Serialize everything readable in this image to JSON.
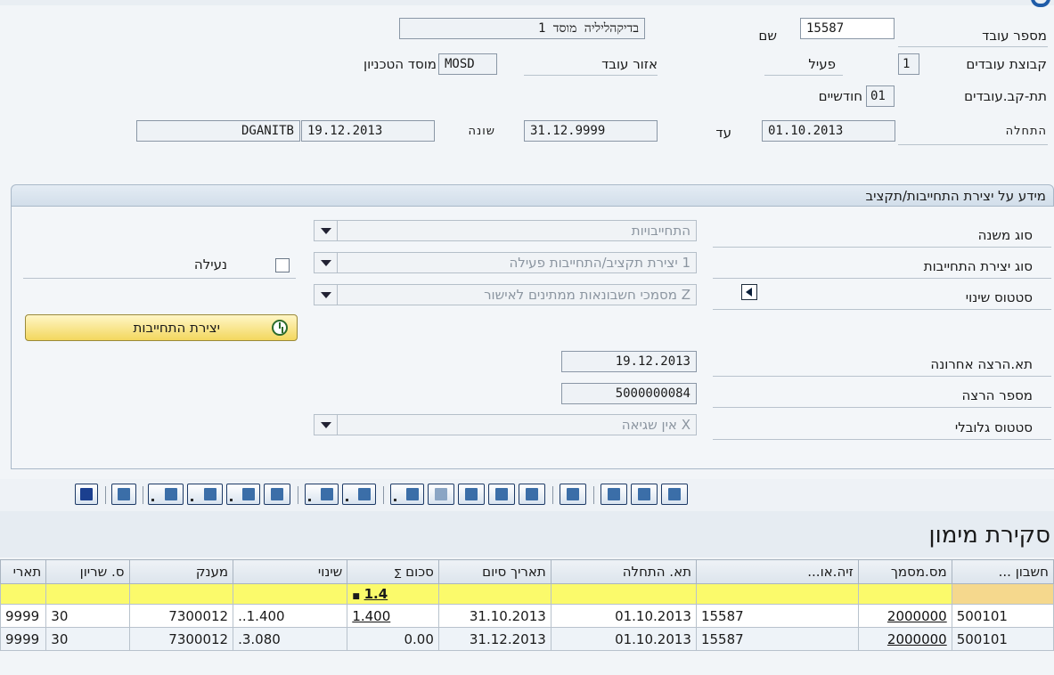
{
  "header": {
    "employee_no_label": "מספר עובד",
    "employee_no": "15587",
    "name_label": "שם",
    "name": "בדיקהליליה מוסד 1",
    "employee_group_label": "קבוצת עובדים",
    "employee_group_code": "1",
    "employee_group_text": "פעיל",
    "employee_area_label": "אזור עובד",
    "employee_area_code": "MOSD",
    "employee_area_text": "מוסד הטכניון",
    "subgroup_label": "תת-קב.עובדים",
    "subgroup_code": "01",
    "subgroup_text": "חודשיים",
    "start_label": "התחלה",
    "start_date": "01.10.2013",
    "until_label": "עד",
    "end_date": "31.12.9999",
    "changed_label": "שונה",
    "changed_date": "19.12.2013",
    "changed_by": "DGANITB"
  },
  "panel": {
    "title": "מידע על יצירת התחייבות/תקציב",
    "sub_type_label": "סוג משנה",
    "sub_type_value": "התחייבויות",
    "creation_type_label": "סוג יצירת התחייבות",
    "creation_type_value": "1 יצירת תקציב/התחייבות פעילה",
    "lock_label": "נעילה",
    "change_status_label": "סטטוס שינוי",
    "change_status_value": "Z מסמכי חשבונאות ממתינים לאישור",
    "create_button": "יצירת התחייבות",
    "last_run_label": "תא.הרצה אחרונה",
    "last_run_date": "19.12.2013",
    "run_no_label": "מספר הרצה",
    "run_no": "5000000084",
    "global_status_label": "סטטוס גלובלי",
    "global_status_value": "X אין שגיאה"
  },
  "grid": {
    "title": "סקירת מימון",
    "columns": [
      "חשבון ...",
      "מס.מסמך",
      "זיה.או...",
      "תא. התחלה",
      "תאריך סיום",
      "סכום",
      "שינוי",
      "מענק",
      "ס. שריון",
      "תארי"
    ],
    "sum_marker": "∑",
    "sum_row": {
      "amount": "1.4"
    },
    "rows": [
      {
        "account": "500101",
        "doc": "2000000",
        "id": "15587",
        "start": "01.10.2013",
        "end": "31.10.2013",
        "amount": "1.400",
        "change": "1.400",
        "grant": "7300012",
        "reserve": "30",
        "date": "9999"
      },
      {
        "account": "500101",
        "doc": "2000000",
        "id": "15587",
        "start": "01.10.2013",
        "end": "31.12.2013",
        "amount": "0.00",
        "change": "3.080",
        "grant": "7300012",
        "reserve": "30",
        "date": "9999"
      }
    ]
  },
  "colors": {
    "panel_header": "#d2deea",
    "sum_row": "#fbfa6b",
    "button": "#f3d75e",
    "accent": "#1f5ca8"
  }
}
